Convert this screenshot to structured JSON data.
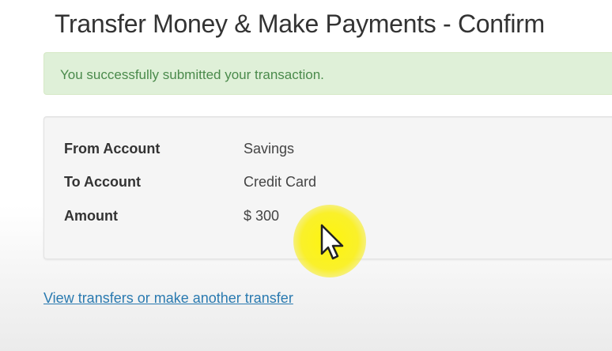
{
  "page": {
    "title": "Transfer Money & Make Payments - Confirm"
  },
  "alert": {
    "message": "You successfully submitted your transaction."
  },
  "details": {
    "rows": [
      {
        "label": "From Account",
        "value": "Savings"
      },
      {
        "label": "To Account",
        "value": "Credit Card"
      },
      {
        "label": "Amount",
        "value": "$ 300"
      }
    ]
  },
  "links": {
    "view_transfers": "View transfers or make another transfer"
  },
  "colors": {
    "alert_background": "#dff0d8",
    "alert_text": "#4a8a4b",
    "link": "#2a7ab0",
    "cursor_highlight": "#fff200"
  },
  "icons": {
    "cursor": "mouse-pointer-icon"
  }
}
